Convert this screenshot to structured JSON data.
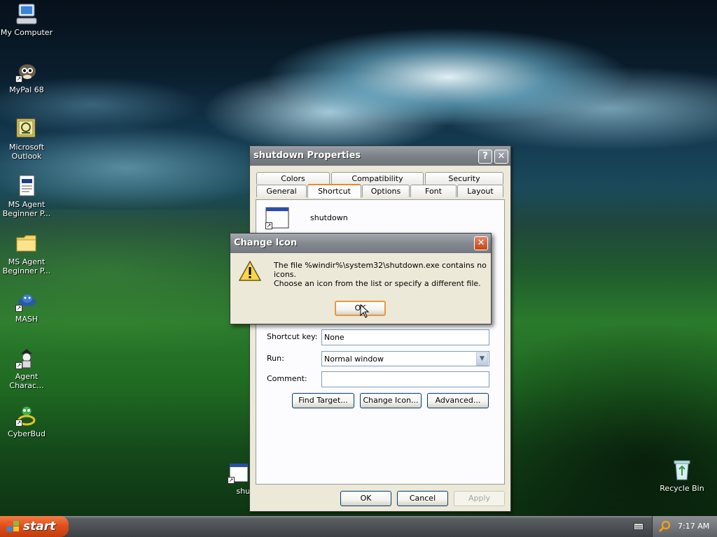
{
  "desktop": {
    "icons": [
      {
        "label": "My Computer",
        "icon": "my-computer-icon"
      },
      {
        "label": "MyPal 68",
        "icon": "mypal-icon"
      },
      {
        "label": "Microsoft Outlook",
        "icon": "outlook-icon"
      },
      {
        "label": "MS Agent Beginner P...",
        "icon": "document-icon"
      },
      {
        "label": "MS Agent Beginner P...",
        "icon": "folder-icon"
      },
      {
        "label": "MASH",
        "icon": "mash-icon"
      },
      {
        "label": "Agent Charac...",
        "icon": "agent-character-icon"
      },
      {
        "label": "CyberBud",
        "icon": "cyberbud-icon"
      },
      {
        "label": "shutd",
        "icon": "shortcut-window-icon"
      },
      {
        "label": "Recycle Bin",
        "icon": "recycle-bin-icon"
      }
    ]
  },
  "properties_dialog": {
    "title": "shutdown Properties",
    "help_glyph": "?",
    "close_glyph": "✕",
    "tabs_top": [
      "Colors",
      "Compatibility",
      "Security"
    ],
    "tabs_bottom": [
      "General",
      "Shortcut",
      "Options",
      "Font",
      "Layout"
    ],
    "active_tab": "Shortcut",
    "shortcut_name": "shutdown",
    "shortcut_key_label": "Shortcut key:",
    "shortcut_key_value": "None",
    "run_label": "Run:",
    "run_value": "Normal window",
    "comment_label": "Comment:",
    "comment_value": "",
    "find_target_label": "Find Target...",
    "change_icon_label": "Change Icon...",
    "advanced_label": "Advanced...",
    "ok_label": "OK",
    "cancel_label": "Cancel",
    "apply_label": "Apply"
  },
  "change_icon_dialog": {
    "title": "Change Icon",
    "close_glyph": "✕",
    "message_line1": "The file %windir%\\system32\\shutdown.exe contains no icons.",
    "message_line2": "Choose an icon from the list or specify a different file.",
    "ok_label": "OK"
  },
  "taskbar": {
    "start_label": "start",
    "clock": "7:17 AM"
  }
}
